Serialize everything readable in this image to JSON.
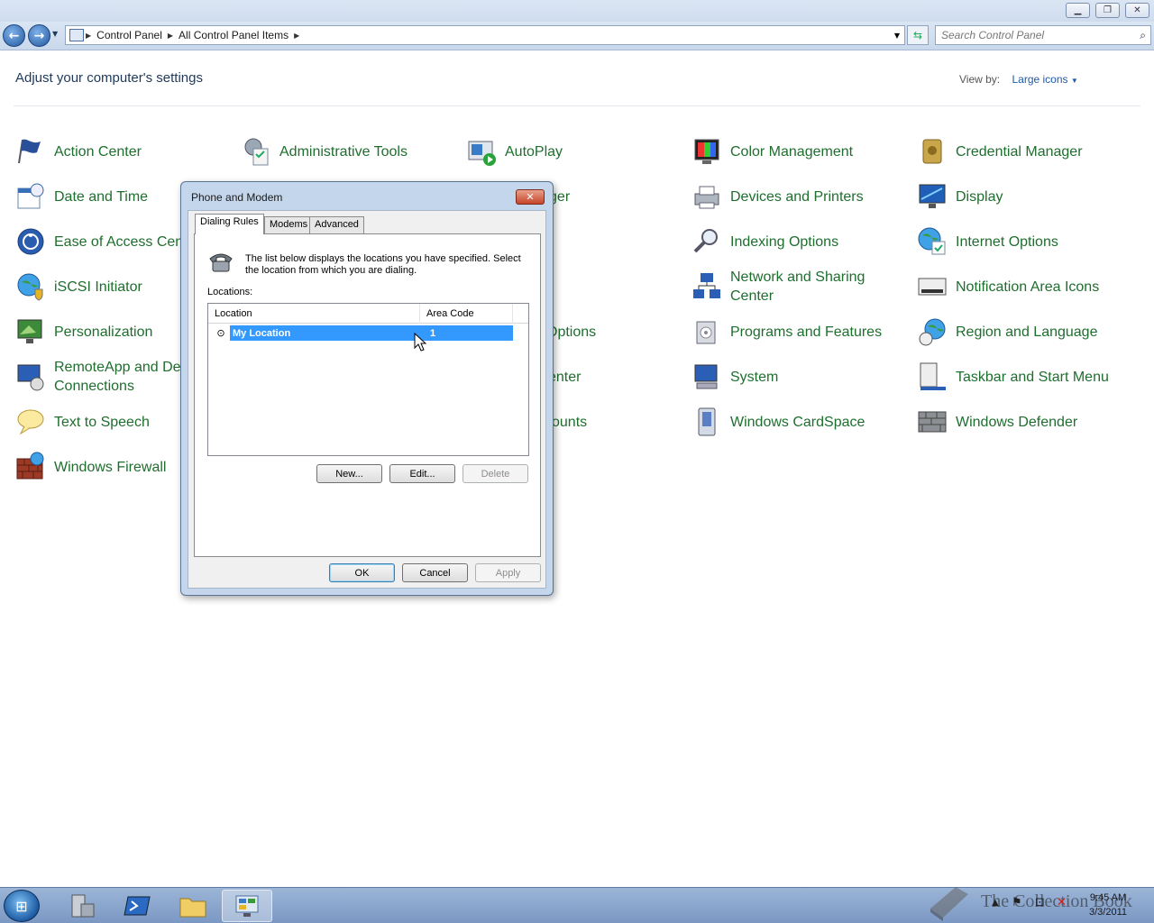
{
  "window": {
    "buttons": [
      "minimize",
      "restore",
      "close"
    ]
  },
  "address_bar": {
    "crumbs": [
      "Control Panel",
      "All Control Panel Items"
    ],
    "search_placeholder": "Search Control Panel"
  },
  "header": {
    "title": "Adjust your computer's settings",
    "view_by_label": "View by:",
    "view_by_value": "Large icons"
  },
  "items": [
    {
      "label": "Action Center",
      "icon": "flag-icon"
    },
    {
      "label": "Administrative Tools",
      "icon": "admin-tools-icon"
    },
    {
      "label": "AutoPlay",
      "icon": "autoplay-icon"
    },
    {
      "label": "Color Management",
      "icon": "color-management-icon"
    },
    {
      "label": "Credential Manager",
      "icon": "credential-vault-icon"
    },
    {
      "label": "Date and Time",
      "icon": "calendar-clock-icon"
    },
    {
      "label": "Manager",
      "icon": ""
    },
    {
      "label": "Devices and Printers",
      "icon": "printer-icon"
    },
    {
      "label": "Display",
      "icon": "monitor-icon"
    },
    {
      "label": "Ease of Access Cente",
      "icon": "ease-of-access-icon"
    },
    {
      "label": "Indexing Options",
      "icon": "indexing-icon"
    },
    {
      "label": "Internet Options",
      "icon": "globe-icon"
    },
    {
      "label": "iSCSI Initiator",
      "icon": "iscsi-globe-icon"
    },
    {
      "label": "Network and Sharing",
      "label2": "Center",
      "icon": "network-icon"
    },
    {
      "label": "Notification Area Icons",
      "icon": "notification-area-icon"
    },
    {
      "label": "Personalization",
      "icon": "personalization-icon"
    },
    {
      "label": "Options",
      "icon": ""
    },
    {
      "label": "Programs and Features",
      "icon": "programs-icon"
    },
    {
      "label": "Region and Language",
      "icon": "region-globe-icon"
    },
    {
      "label": "RemoteApp and Des",
      "label2": "Connections",
      "icon": "remoteapp-icon"
    },
    {
      "label": "enter",
      "icon": ""
    },
    {
      "label": "System",
      "icon": "system-icon"
    },
    {
      "label": "Taskbar and Start Menu",
      "icon": "taskbar-icon"
    },
    {
      "label": "Text to Speech",
      "icon": "speech-bubble-icon"
    },
    {
      "label": "counts",
      "icon": ""
    },
    {
      "label": "Windows CardSpace",
      "icon": "cardspace-icon"
    },
    {
      "label": "Windows Defender",
      "icon": "defender-icon"
    },
    {
      "label": "Windows Firewall",
      "icon": "firewall-icon"
    }
  ],
  "dialog": {
    "title": "Phone and Modem",
    "tabs": [
      "Dialing Rules",
      "Modems",
      "Advanced"
    ],
    "active_tab": "Dialing Rules",
    "description": "The list below displays the locations you have specified. Select the location from which you are dialing.",
    "locations_label": "Locations:",
    "columns": [
      "Location",
      "Area Code"
    ],
    "rows": [
      {
        "location": "My Location",
        "area_code": "1",
        "selected": true
      }
    ],
    "list_buttons": {
      "new": "New...",
      "edit": "Edit...",
      "delete": "Delete"
    },
    "footer_buttons": {
      "ok": "OK",
      "cancel": "Cancel",
      "apply": "Apply"
    }
  },
  "taskbar": {
    "clock_time": "9:45 AM",
    "clock_date": "3/3/2011",
    "watermark": "The Collection Book"
  },
  "colors": {
    "link_green": "#1e6e2e",
    "selection": "#3399ff",
    "dialog_frame": "#c4d6ec"
  }
}
